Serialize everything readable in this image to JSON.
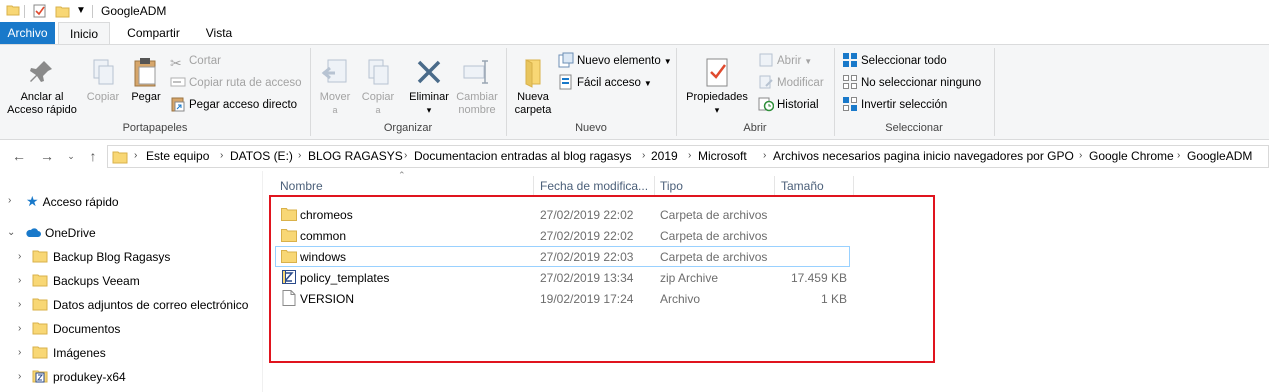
{
  "window": {
    "title": "GoogleADM"
  },
  "tabs": [
    {
      "label": "Archivo"
    },
    {
      "label": "Inicio"
    },
    {
      "label": "Compartir"
    },
    {
      "label": "Vista"
    }
  ],
  "ribbon": {
    "portapapeles": {
      "label": "Portapapeles",
      "pin": "Anclar al\nAcceso rápido",
      "pin_line1": "Anclar al",
      "pin_line2": "Acceso rápido",
      "copy": "Copiar",
      "paste": "Pegar",
      "cut": "Cortar",
      "copy_path": "Copiar ruta de acceso",
      "paste_shortcut": "Pegar acceso directo"
    },
    "organizar": {
      "label": "Organizar",
      "move_line1": "Mover",
      "move_line2": "a",
      "copy_line1": "Copiar",
      "copy_line2": "a",
      "delete_line1": "Eliminar",
      "rename_line1": "Cambiar",
      "rename_line2": "nombre"
    },
    "nuevo": {
      "label": "Nuevo",
      "new_folder_line1": "Nueva",
      "new_folder_line2": "carpeta",
      "new_item": "Nuevo elemento",
      "easy_access": "Fácil acceso"
    },
    "abrir": {
      "label": "Abrir",
      "properties": "Propiedades",
      "open": "Abrir",
      "edit": "Modificar",
      "history": "Historial"
    },
    "seleccionar": {
      "label": "Seleccionar",
      "select_all": "Seleccionar todo",
      "select_none": "No seleccionar ninguno",
      "invert": "Invertir selección"
    }
  },
  "address": {
    "crumbs": [
      "Este equipo",
      "DATOS (E:)",
      "BLOG RAGASYS",
      "Documentacion entradas al blog ragasys",
      "2019",
      "Microsoft",
      "Archivos necesarios pagina inicio navegadores por GPO",
      "Google Chrome",
      "GoogleADM"
    ]
  },
  "nav": {
    "items": [
      {
        "label": "Acceso rápido",
        "icon": "star-icon"
      },
      {
        "label": "OneDrive",
        "icon": "cloud-icon"
      },
      {
        "label": "Backup Blog Ragasys",
        "icon": "folder-icon"
      },
      {
        "label": "Backups Veeam",
        "icon": "folder-icon"
      },
      {
        "label": "Datos adjuntos de correo electrónico",
        "icon": "folder-icon"
      },
      {
        "label": "Documentos",
        "icon": "folder-icon"
      },
      {
        "label": "Imágenes",
        "icon": "folder-icon"
      },
      {
        "label": "produkey-x64",
        "icon": "zip-folder-icon"
      }
    ]
  },
  "files": {
    "columns": [
      "Nombre",
      "Fecha de modifica...",
      "Tipo",
      "Tamaño"
    ],
    "rows": [
      {
        "name": "chromeos",
        "date": "27/02/2019 22:02",
        "type": "Carpeta de archivos",
        "size": "",
        "icon": "folder-icon"
      },
      {
        "name": "common",
        "date": "27/02/2019 22:02",
        "type": "Carpeta de archivos",
        "size": "",
        "icon": "folder-icon"
      },
      {
        "name": "windows",
        "date": "27/02/2019 22:03",
        "type": "Carpeta de archivos",
        "size": "",
        "icon": "folder-icon"
      },
      {
        "name": "policy_templates",
        "date": "27/02/2019 13:34",
        "type": "zip Archive",
        "size": "17.459 KB",
        "icon": "zip-icon"
      },
      {
        "name": "VERSION",
        "date": "19/02/2019 17:24",
        "type": "Archivo",
        "size": "1 KB",
        "icon": "file-icon"
      }
    ]
  },
  "colors": {
    "accent": "#1979ca",
    "folder": "#f8d775",
    "highlight": "#e0141e",
    "selection_border": "#99d1ff"
  }
}
